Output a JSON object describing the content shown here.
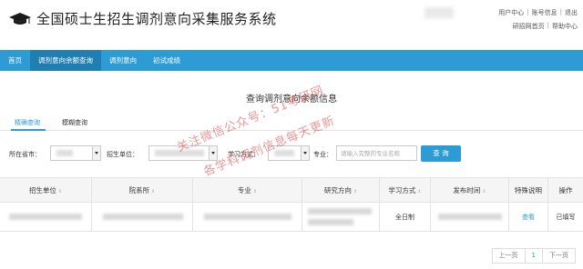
{
  "header": {
    "title": "全国硕士生招生调剂意向采集服务系统",
    "top_links": [
      "用户中心",
      "账号信息",
      "退出"
    ],
    "second_links": [
      "研招网首页",
      "帮助中心"
    ],
    "separator": "|"
  },
  "nav": {
    "items": [
      {
        "label": "首页",
        "active": false
      },
      {
        "label": "调剂意向余额查询",
        "active": true
      },
      {
        "label": "调剂意向",
        "active": false
      },
      {
        "label": "初试成绩",
        "active": false
      }
    ]
  },
  "panel": {
    "title": "查询调剂意向余额信息",
    "tabs": [
      {
        "label": "精确查询",
        "active": true
      },
      {
        "label": "模糊查询",
        "active": false
      }
    ]
  },
  "filters": {
    "province_label": "所在省市：",
    "unit_label": "招生单位：",
    "mode_label": "学习方式：",
    "major_label": "专业：",
    "major_placeholder": "请输入完整的专业名称",
    "search_button": "查 询"
  },
  "table": {
    "columns": [
      "招生单位",
      "院系所",
      "专业",
      "研究方向",
      "学习方式",
      "发布时间",
      "特殊说明",
      "操作"
    ],
    "rows": [
      {
        "mode": "全日制",
        "remark_link": "查看",
        "action": "已填写"
      }
    ]
  },
  "pager": {
    "prev": "上一页",
    "current": "1",
    "next": "下一页"
  },
  "watermark": {
    "line1": "关注微信公众号：51考研网",
    "line2": "各学科调剂信息每天更新"
  },
  "colors": {
    "accent": "#2e9cd4",
    "nav_active": "#1f7fb3",
    "watermark": "#e13c3c"
  }
}
